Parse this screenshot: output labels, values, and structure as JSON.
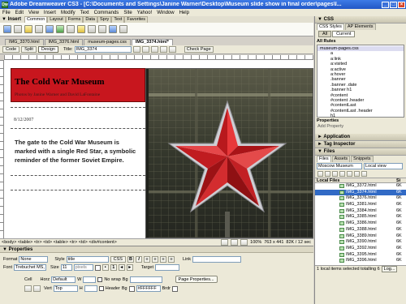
{
  "window": {
    "title": "Adobe Dreamweaver CS3 - [C:\\Documents and Settings\\Janine Warner\\Desktop\\Museum slide show in final order\\pages\\I...",
    "logo": "Dw",
    "buttons": [
      "_",
      "□",
      "×"
    ]
  },
  "menu": [
    "File",
    "Edit",
    "View",
    "Insert",
    "Modify",
    "Text",
    "Commands",
    "Site",
    "Yahoo!",
    "Window",
    "Help"
  ],
  "insert_panel": {
    "title": "▼ Insert",
    "tabs": [
      "Common",
      "Layout",
      "Forms",
      "Data",
      "Spry",
      "Text",
      "Favorites"
    ],
    "active_tab": "Common"
  },
  "doc_tabs": [
    {
      "label": "IMG_3370.html",
      "active": false
    },
    {
      "label": "IMG_3376.html",
      "active": false
    },
    {
      "label": "museum-pages.css",
      "active": false
    },
    {
      "label": "IMG_3374.html*",
      "active": true
    }
  ],
  "doc_toolbar": {
    "views": [
      "Code",
      "Split",
      "Design"
    ],
    "active_view": "Design",
    "title_label": "Title:",
    "title_value": "IMG_3374",
    "check_page": "Check Page"
  },
  "page": {
    "site_title": "The Cold War Museum",
    "credit": "Photos by Janine Warner and David LaFontaine",
    "date": "8/12/2007",
    "caption": "The gate to the Cold War Museum is marked with a single Red Star, a symbolic reminder of the former Soviet Empire."
  },
  "status_bar": {
    "tags": "<body> <table> <tr> <td> <table> <tr> <td> <div#content>",
    "zoom": "100%",
    "size": "763 x 441",
    "file_info": "82K / 12 sec"
  },
  "properties": {
    "title": "▼ Properties",
    "format_label": "Format",
    "format_value": "None",
    "style_label": "Style",
    "style_value": "title",
    "css_button": "CSS",
    "link_label": "Link",
    "font_label": "Font",
    "font_value": "Trebuchet MS,",
    "size_label": "Size",
    "size_value": "11",
    "size_unit": "pixels",
    "target_label": "Target",
    "cell_label": "Cell",
    "horz_label": "Horz",
    "horz_value": "Default",
    "w_label": "W",
    "nowrap_label": "No wrap",
    "bg_label": "Bg",
    "page_props_button": "Page Properties...",
    "vert_label": "Vert",
    "vert_value": "Top",
    "h_label": "H",
    "header_label": "Header",
    "bg2_label": "Bg",
    "color_value": "#FFFFFF",
    "brdr_label": "Brdr"
  },
  "css_panel": {
    "header": "▼ CSS",
    "tabs": [
      "CSS Styles",
      "AP Elements"
    ],
    "active_tab": "CSS Styles",
    "modes": [
      "All",
      "Current"
    ],
    "rules_label": "All Rules",
    "rules_root": "museum-pages.css",
    "rules": [
      "a",
      "a:link",
      "a:visited",
      "a:active",
      "a:hover",
      ".banner",
      ".banner .date",
      ".banner h1",
      "#content",
      "#content .header",
      "#contentLast",
      "#contentLast .header",
      "h1"
    ]
  },
  "properties_sub": {
    "header": "Properties",
    "add_text": "Add Property"
  },
  "collapsed_panels": [
    "► Application",
    "► Tag Inspector"
  ],
  "files_panel": {
    "header": "▼ Files",
    "tabs": [
      "Files",
      "Assets",
      "Snippets"
    ],
    "active_tab": "Files",
    "site": "Moscow Museum",
    "view": "Local view",
    "col_local": "Local Files",
    "col_size": "Si",
    "files": [
      {
        "name": "IMG_3372.html",
        "size": "6K",
        "selected": false
      },
      {
        "name": "IMG_3374.html",
        "size": "6K",
        "selected": true
      },
      {
        "name": "IMG_3376.html",
        "size": "6K",
        "selected": false
      },
      {
        "name": "IMG_3381.html",
        "size": "6K",
        "selected": false
      },
      {
        "name": "IMG_3384.html",
        "size": "6K",
        "selected": false
      },
      {
        "name": "IMG_3385.html",
        "size": "6K",
        "selected": false
      },
      {
        "name": "IMG_3386.html",
        "size": "6K",
        "selected": false
      },
      {
        "name": "IMG_3388.html",
        "size": "6K",
        "selected": false
      },
      {
        "name": "IMG_3389.html",
        "size": "6K",
        "selected": false
      },
      {
        "name": "IMG_3390.html",
        "size": "6K",
        "selected": false
      },
      {
        "name": "IMG_3392.html",
        "size": "6K",
        "selected": false
      },
      {
        "name": "IMG_3395.html",
        "size": "6K",
        "selected": false
      },
      {
        "name": "IMG_3396.html",
        "size": "6K",
        "selected": false
      }
    ],
    "status": "1 local items selected totalling 6",
    "log_button": "Log..."
  }
}
